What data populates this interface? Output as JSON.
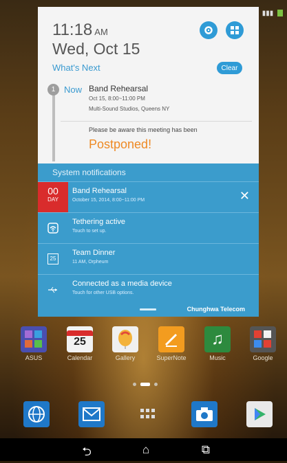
{
  "status_bar": {
    "signal": "4G",
    "battery_color": "#7cc242"
  },
  "notification_panel": {
    "clock": {
      "time": "11:18",
      "ampm": "AM",
      "date": "Wed, Oct 15"
    },
    "settings_icon": "gear-icon",
    "quick_settings_icon": "grid-icon",
    "whats_next": {
      "label": "What's Next",
      "clear_label": "Clear",
      "event_step": "1",
      "now_label": "Now",
      "event_title": "Band Rehearsal",
      "event_time": "Oct 15, 8:00~11:00 PM",
      "event_location": "Multi-Sound Studios, Queens NY",
      "notice": "Please be aware this meeting has been",
      "status": "Postponed!"
    },
    "system_notifications": {
      "header": "System notifications",
      "items": [
        {
          "icon": "calendar-icon",
          "icon_day": "00",
          "icon_label": "DAY",
          "title": "Band Rehearsal",
          "subtitle": "October 15, 2014, 8:00~11:00 PM",
          "dismiss": "✕"
        },
        {
          "icon": "wifi-tethering-icon",
          "title": "Tethering active",
          "subtitle": "Touch to set up."
        },
        {
          "icon": "calendar-icon",
          "icon_day": "25",
          "title": "Team Dinner",
          "subtitle": "11 AM, Orpheum"
        },
        {
          "icon": "usb-icon",
          "title": "Connected as a media device",
          "subtitle": "Touch for other USB options."
        }
      ],
      "carrier": "Chunghwa Telecom"
    },
    "accent_color": "#2f9bd6",
    "postponed_color": "#ee8a25"
  },
  "home": {
    "apps": [
      {
        "label": "ASUS",
        "icon": "asus-folder-icon",
        "day": ""
      },
      {
        "label": "Calendar",
        "icon": "calendar-icon",
        "day": "25"
      },
      {
        "label": "Gallery",
        "icon": "gallery-balloon-icon",
        "day": ""
      },
      {
        "label": "SuperNote",
        "icon": "supernote-pen-icon",
        "day": ""
      },
      {
        "label": "Music",
        "icon": "music-note-icon",
        "day": ""
      },
      {
        "label": "Google",
        "icon": "google-folder-icon",
        "day": ""
      }
    ],
    "dock": [
      {
        "icon": "browser-globe-icon"
      },
      {
        "icon": "email-icon"
      },
      {
        "icon": "app-drawer-icon"
      },
      {
        "icon": "camera-icon"
      },
      {
        "icon": "play-store-icon"
      }
    ]
  },
  "navbar": {
    "back": "⮌",
    "home": "⌂",
    "recents": "⧉"
  }
}
